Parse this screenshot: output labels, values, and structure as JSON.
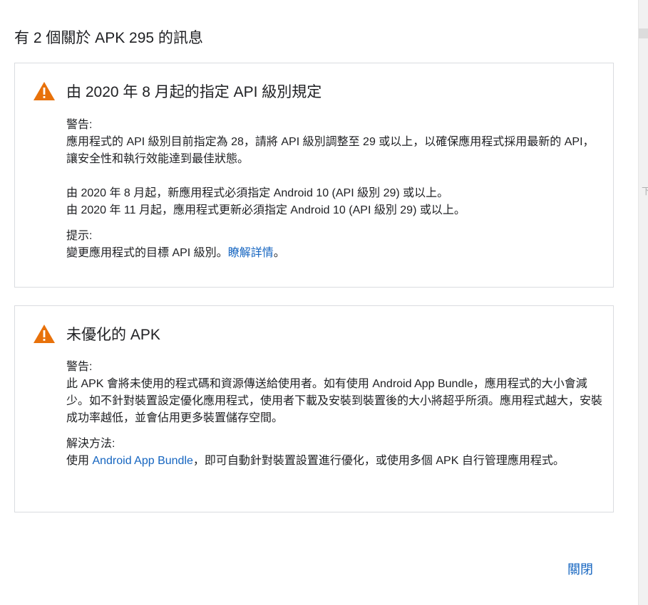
{
  "dialog": {
    "title": "有 2 個關於 APK 295 的訊息",
    "close_label": "關閉"
  },
  "cards": [
    {
      "icon": "warning-icon",
      "title": "由 2020 年 8 月起的指定 API 級別規定",
      "warning_label": "警告:",
      "warning_text": "應用程式的 API 級別目前指定為 28，請將 API 級別調整至 29 或以上，以確保應用程式採用最新的 API，讓安全性和執行效能達到最佳狀態。",
      "rule_1": "由 2020 年 8 月起，新應用程式必須指定 Android 10 (API 級別 29) 或以上。",
      "rule_2": "由 2020 年 11 月起，應用程式更新必須指定 Android 10 (API 級別 29) 或以上。",
      "tip_label": "提示:",
      "tip_text": "變更應用程式的目標 API 級別。",
      "tip_link": "瞭解詳情",
      "tip_end": "。"
    },
    {
      "icon": "warning-icon",
      "title": "未優化的 APK",
      "warning_label": "警告:",
      "warning_text": "此 APK 會將未使用的程式碼和資源傳送給使用者。如有使用 Android App Bundle，應用程式的大小會減少。如不針對裝置設定優化應用程式，使用者下載及安裝到裝置後的大小將超乎所須。應用程式越大，安裝成功率越低，並會佔用更多裝置儲存空間。",
      "solution_label": "解決方法:",
      "solution_prefix": "使用 ",
      "solution_link": "Android App Bundle",
      "solution_suffix": "，即可自動針對裝置設置進行優化，或使用多個 APK 自行管理應用程式。"
    }
  ],
  "colors": {
    "warning": "#e8710a",
    "link": "#1565c0",
    "border": "#dadce0"
  }
}
